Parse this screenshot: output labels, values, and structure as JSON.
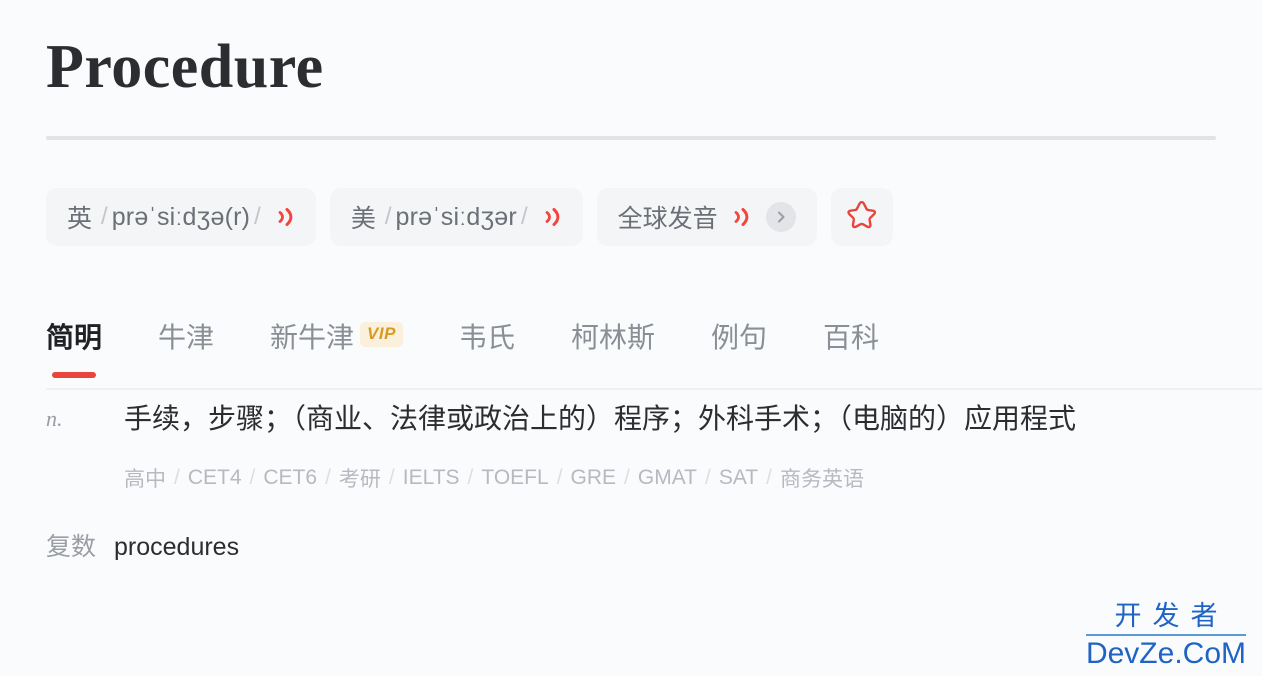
{
  "entry": {
    "headword": "Procedure"
  },
  "pronunciations": [
    {
      "name": "british",
      "lang_label": "英",
      "ipa": "prəˈsiːdʒə(r)",
      "speaker_icon": "speaker-icon"
    },
    {
      "name": "american",
      "lang_label": "美",
      "ipa": "prəˈsiːdʒər",
      "speaker_icon": "speaker-icon"
    }
  ],
  "global_pron": {
    "label": "全球发音",
    "speaker_icon": "speaker-icon",
    "chevron_icon": "chevron-right-icon"
  },
  "favorite": {
    "icon": "star-icon",
    "color": "#e8453c"
  },
  "tabs": [
    {
      "label": "简明",
      "active": true,
      "badge": ""
    },
    {
      "label": "牛津",
      "active": false,
      "badge": ""
    },
    {
      "label": "新牛津",
      "active": false,
      "badge": "VIP"
    },
    {
      "label": "韦氏",
      "active": false,
      "badge": ""
    },
    {
      "label": "柯林斯",
      "active": false,
      "badge": ""
    },
    {
      "label": "例句",
      "active": false,
      "badge": ""
    },
    {
      "label": "百科",
      "active": false,
      "badge": ""
    }
  ],
  "senses": [
    {
      "pos": "n.",
      "definition": "手续，步骤；（商业、法律或政治上的）程序；外科手术；（电脑的）应用程式",
      "exam_tags": [
        "高中",
        "CET4",
        "CET6",
        "考研",
        "IELTS",
        "TOEFL",
        "GRE",
        "GMAT",
        "SAT",
        "商务英语"
      ]
    }
  ],
  "inflection": {
    "label": "复数",
    "value": "procedures"
  },
  "watermark": {
    "cn": "开发者",
    "en": "DevZe.CoM"
  },
  "colors": {
    "accent_red": "#e8453c",
    "vip_gold": "#d79b22",
    "page_bg": "#fafbfc",
    "chip_bg": "#f4f5f7"
  }
}
